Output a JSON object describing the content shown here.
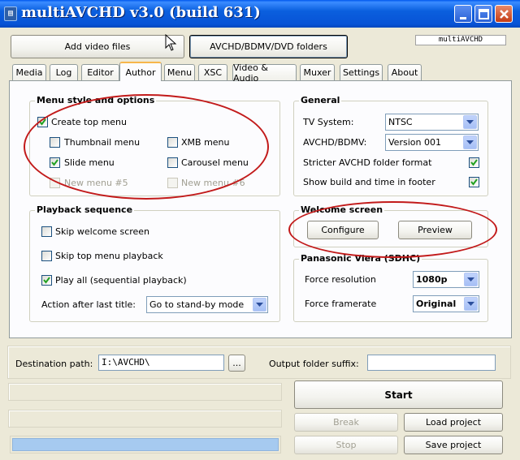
{
  "window": {
    "title": "multiAVCHD v3.0 (build 631)",
    "app_icon": "film-icon"
  },
  "top": {
    "add_video_files": "Add video files",
    "avchd_folders": "AVCHD/BDMV/DVD folders",
    "brand_label": "multiAVCHD"
  },
  "tabs": [
    {
      "label": "Media"
    },
    {
      "label": "Log"
    },
    {
      "label": "Editor"
    },
    {
      "label": "Author",
      "active": true
    },
    {
      "label": "Menu"
    },
    {
      "label": "XSC"
    },
    {
      "label": "Video & Audio"
    },
    {
      "label": "Muxer"
    },
    {
      "label": "Settings"
    },
    {
      "label": "About"
    }
  ],
  "menu_style": {
    "title": "Menu style and options",
    "create_top_menu": {
      "label": "Create top menu",
      "checked": true
    },
    "thumbnail_menu": {
      "label": "Thumbnail menu",
      "checked": false
    },
    "xmb_menu": {
      "label": "XMB menu",
      "checked": false
    },
    "slide_menu": {
      "label": "Slide menu",
      "checked": true
    },
    "carousel_menu": {
      "label": "Carousel menu",
      "checked": false
    },
    "new_menu_5": {
      "label": "New menu #5",
      "checked": false,
      "disabled": true
    },
    "new_menu_6": {
      "label": "New menu #6",
      "checked": false,
      "disabled": true
    }
  },
  "playback": {
    "title": "Playback sequence",
    "skip_welcome": {
      "label": "Skip welcome screen",
      "checked": false
    },
    "skip_top_menu": {
      "label": "Skip top menu playback",
      "checked": false
    },
    "play_all": {
      "label": "Play all (sequential playback)",
      "checked": true
    },
    "action_label": "Action after last title:",
    "action_value": "Go to stand-by mode"
  },
  "general": {
    "title": "General",
    "tv_system_label": "TV System:",
    "tv_system_value": "NTSC",
    "avchd_bdmv_label": "AVCHD/BDMV:",
    "avchd_bdmv_value": "Version 001",
    "stricter_label": "Stricter AVCHD folder format",
    "stricter_checked": true,
    "show_build_label": "Show build and time in footer",
    "show_build_checked": true
  },
  "welcome": {
    "title": "Welcome screen",
    "configure": "Configure",
    "preview": "Preview"
  },
  "panasonic": {
    "title": "Panasonic Viera (SDHC)",
    "force_resolution_label": "Force resolution",
    "force_resolution_value": "1080p",
    "force_framerate_label": "Force framerate",
    "force_framerate_value": "Original"
  },
  "bottom": {
    "destination_label": "Destination path:",
    "destination_value": "I:\\AVCHD\\",
    "browse": "...",
    "suffix_label": "Output folder suffix:",
    "suffix_value": "",
    "start": "Start",
    "break": "Break",
    "stop": "Stop",
    "load_project": "Load project",
    "save_project": "Save project"
  },
  "colors": {
    "annotation": "#c21a1a",
    "progress_fill": "#a6caf0",
    "titlebar": "#0a5fde"
  }
}
